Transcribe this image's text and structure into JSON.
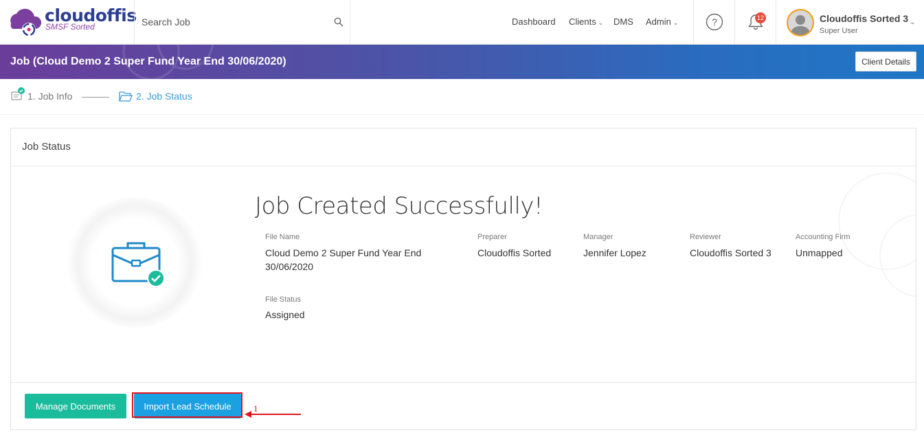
{
  "brand": {
    "name": "cloudoffis",
    "tagline": "SMSF Sorted"
  },
  "search": {
    "placeholder": "Search Job"
  },
  "nav": {
    "dashboard": "Dashboard",
    "clients": "Clients",
    "dms": "DMS",
    "admin": "Admin"
  },
  "notifications": {
    "count": "12"
  },
  "user": {
    "name": "Cloudoffis Sorted 3",
    "role": "Super User"
  },
  "banner": {
    "title": "Job (Cloud Demo 2 Super Fund Year End 30/06/2020)",
    "client_details_label": "Client Details"
  },
  "steps": [
    {
      "label": "1. Job Info",
      "state": "completed"
    },
    {
      "label": "2. Job Status",
      "state": "active"
    }
  ],
  "card": {
    "title": "Job Status",
    "success_message": "Job Created Successfully!",
    "fields": {
      "file_name": {
        "label": "File Name",
        "value_line1": "Cloud Demo 2 Super Fund Year End",
        "value_line2": "30/06/2020"
      },
      "preparer": {
        "label": "Preparer",
        "value": "Cloudoffis Sorted"
      },
      "manager": {
        "label": "Manager",
        "value": "Jennifer Lopez"
      },
      "reviewer": {
        "label": "Reviewer",
        "value": "Cloudoffis Sorted 3"
      },
      "accounting_firm": {
        "label": "Accounting Firm",
        "value": "Unmapped"
      },
      "file_status": {
        "label": "File Status",
        "value": "Assigned"
      }
    },
    "buttons": {
      "manage_documents": "Manage Documents",
      "import_lead_schedule": "Import Lead Schedule"
    }
  },
  "annotation": {
    "number": "1"
  },
  "colors": {
    "accent_green": "#1abc9c",
    "accent_blue": "#1ba1e2",
    "brand_navy": "#2c3e8f",
    "annotation_red": "#e3141b"
  }
}
